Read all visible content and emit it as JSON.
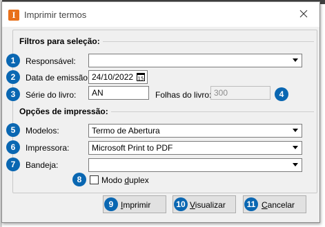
{
  "window": {
    "icon_letter": "I",
    "title": "Imprimir termos",
    "close_glyph": "close-icon"
  },
  "filters": {
    "title": "Filtros para seleção:",
    "responsavel": {
      "badge": "1",
      "label": "Responsável:",
      "value": ""
    },
    "data_emissao": {
      "badge": "2",
      "label": "Data de emissão:",
      "value": "24/10/2022",
      "calendar_day": "15"
    },
    "serie": {
      "badge": "3",
      "label": "Série do livro:",
      "value": "AN"
    },
    "folhas": {
      "badge": "4",
      "label": "Folhas do livro:",
      "value": "300"
    }
  },
  "options": {
    "title": "Opções de impressão:",
    "modelos": {
      "badge": "5",
      "label": "Modelos:",
      "value": "Termo de Abertura"
    },
    "impressora": {
      "badge": "6",
      "label": "Impressora:",
      "value": "Microsoft Print to PDF"
    },
    "bandeja": {
      "badge": "7",
      "label": "Bandeja:",
      "value": ""
    },
    "duplex": {
      "badge": "8",
      "label_pre": "Modo ",
      "label_acc": "d",
      "label_post": "uplex",
      "checked": false
    }
  },
  "buttons": {
    "imprimir": {
      "badge": "9",
      "acc": "I",
      "rest": "mprimir"
    },
    "visualizar": {
      "badge": "10",
      "acc": "V",
      "rest": "isualizar"
    },
    "cancelar": {
      "badge": "11",
      "acc": "C",
      "rest": "ancelar"
    }
  },
  "colors": {
    "badge": "#0a67b2",
    "app_icon": "#e8701a",
    "dialog_bg": "#f0f0f0"
  }
}
